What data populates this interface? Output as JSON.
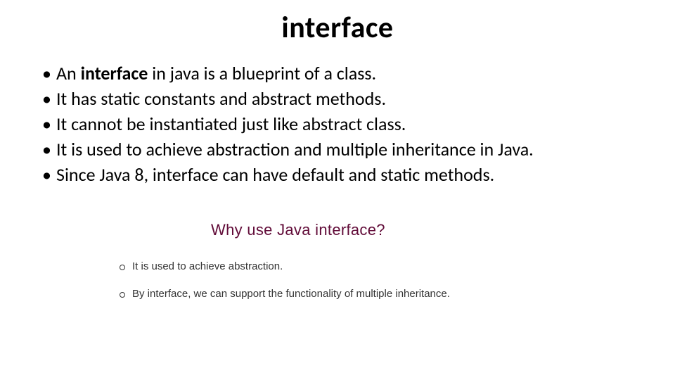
{
  "title": "interface",
  "bullets": {
    "b0_prefix": "An ",
    "b0_strong": "interface",
    "b0_suffix": " in java is a blueprint of a class.",
    "b1": "It has static constants and abstract methods.",
    "b2": "It cannot be instantiated just like abstract class.",
    "b3": "It is used to achieve abstraction and multiple inheritance in Java.",
    "b4": "Since Java 8, interface can have default and static methods."
  },
  "sub": {
    "heading": "Why use Java interface?",
    "items": {
      "s0": "It is used to achieve abstraction.",
      "s1": "By interface, we can support the functionality of multiple inheritance."
    }
  }
}
